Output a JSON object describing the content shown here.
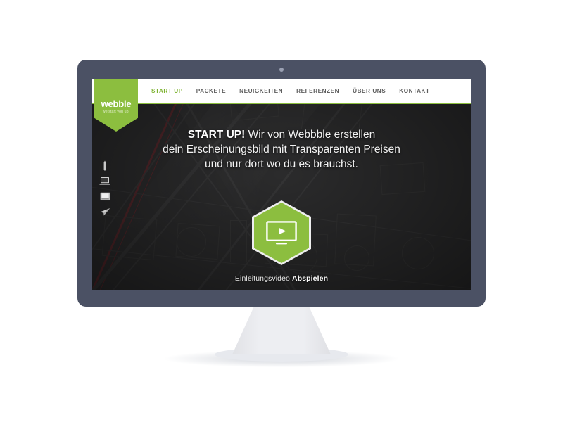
{
  "device": {
    "type": "desktop-monitor",
    "bezel_color": "#4b5164",
    "stand_color": "#edeef2",
    "webcam": "webcam-dot"
  },
  "brand": {
    "accent_green": "#8cbe3f",
    "logo_name": "webble",
    "logo_tagline": "we start you up!"
  },
  "nav": {
    "items": [
      {
        "label": "START UP",
        "active": true
      },
      {
        "label": "PACKETE",
        "active": false
      },
      {
        "label": "NEUIGKEITEN",
        "active": false
      },
      {
        "label": "REFERENZEN",
        "active": false
      },
      {
        "label": "ÜBER UNS",
        "active": false
      },
      {
        "label": "KONTAKT",
        "active": false
      }
    ],
    "bar_background": "#ffffff",
    "underline_color": "#8cbe3f"
  },
  "sidebar": {
    "icons": [
      {
        "name": "pen-icon",
        "label": "Design"
      },
      {
        "name": "laptop-icon",
        "label": "Laptop"
      },
      {
        "name": "desktop-icon",
        "label": "Desktop"
      },
      {
        "name": "paper-plane-icon",
        "label": "Senden"
      }
    ]
  },
  "hero": {
    "headline_strong": "START UP!",
    "headline_line1_rest": " Wir von Webbble erstellen",
    "headline_line2": "dein Erscheinungsbild mit Transparenten Preisen",
    "headline_line3": "und nur dort wo du es brauchst.",
    "background": "blueprint-sketch-dark",
    "background_color": "#303031"
  },
  "video": {
    "button_name": "play-video-hexagon",
    "icon": "monitor-play-icon",
    "hex_fill": "#8cbe3f",
    "hex_border": "#ffffff",
    "caption_prefix": "Einleitungsvideo",
    "caption_action": "Abspielen"
  }
}
